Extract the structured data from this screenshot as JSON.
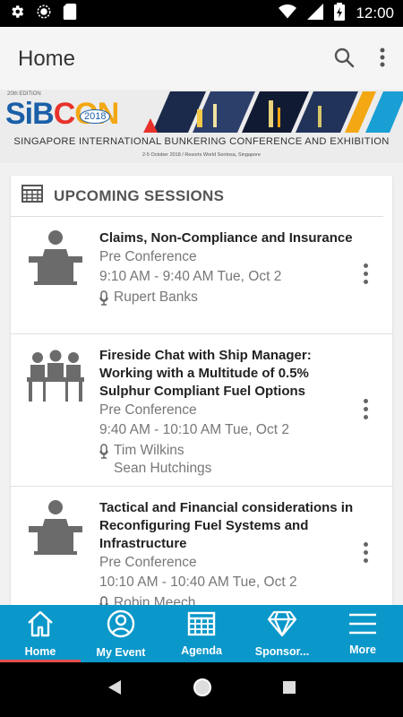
{
  "status_bar": {
    "time": "12:00"
  },
  "app_bar": {
    "title": "Home"
  },
  "banner": {
    "edition": "20th EDITION",
    "logo_parts": [
      "SiB",
      "C",
      "ON"
    ],
    "year": "2018",
    "subtitle": "SINGAPORE INTERNATIONAL BUNKERING CONFERENCE AND EXHIBITION",
    "venue": "2-5 October 2018 / Resorts World Sentosa, Singapore"
  },
  "sessions_section": {
    "header": "UPCOMING SESSIONS",
    "items": [
      {
        "title": "Claims, Non-Compliance and Insurance",
        "track": "Pre Conference",
        "time": "9:10 AM - 9:40 AM Tue, Oct 2",
        "speakers": [
          "Rupert Banks"
        ],
        "icon": "podium-speaker-icon"
      },
      {
        "title": "Fireside Chat with Ship Manager: Working with a Multitude of 0.5% Sulphur Compliant Fuel Options",
        "track": "Pre Conference",
        "time": "9:40 AM - 10:10 AM Tue, Oct 2",
        "speakers": [
          "Tim Wilkins",
          "Sean Hutchings"
        ],
        "icon": "panel-discussion-icon"
      },
      {
        "title": "Tactical and Financial considerations in Reconfiguring Fuel Systems and Infrastructure",
        "track": "Pre Conference",
        "time": "10:10 AM - 10:40 AM Tue, Oct 2",
        "speakers": [
          "Robin Meech"
        ],
        "icon": "podium-speaker-icon"
      }
    ]
  },
  "bottom_nav": {
    "items": [
      {
        "label": "Home",
        "icon": "home-icon",
        "active": true
      },
      {
        "label": "My Event",
        "icon": "person-icon",
        "active": false
      },
      {
        "label": "Agenda",
        "icon": "calendar-icon",
        "active": false
      },
      {
        "label": "Sponsor...",
        "icon": "diamond-icon",
        "active": false
      },
      {
        "label": "More",
        "icon": "hamburger-icon",
        "active": false
      }
    ]
  },
  "colors": {
    "accent": "#0a97c9",
    "active_indicator": "#e05050"
  }
}
